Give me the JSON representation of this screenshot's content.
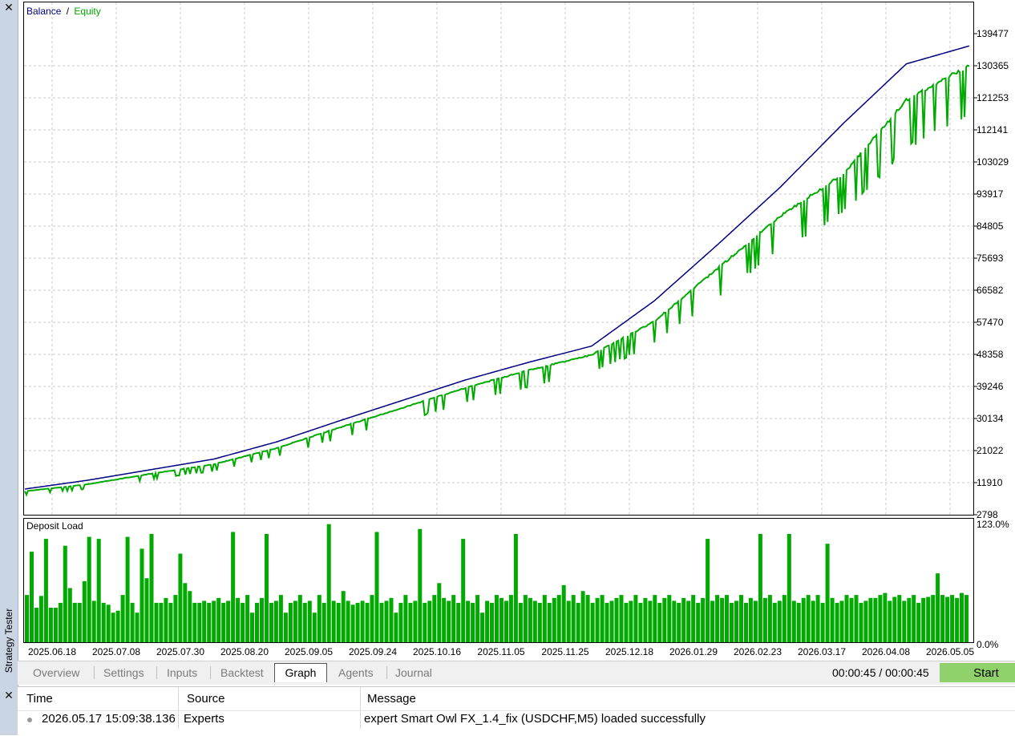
{
  "window": {
    "title": "Strategy Tester"
  },
  "chart": {
    "legend_balance": "Balance",
    "legend_separator": "/",
    "legend_equity": "Equity",
    "deposit_title": "Deposit Load",
    "colors": {
      "balance": "#000080",
      "equity": "#00aa00",
      "deposit": "#00aa00",
      "grid": "#c8c8c8"
    }
  },
  "chart_data": [
    {
      "type": "line",
      "title": "",
      "series": [
        {
          "name": "Balance",
          "color": "#000080",
          "x": [
            "2025.06.18",
            "2025.07.08",
            "2025.07.30",
            "2025.08.20",
            "2025.09.05",
            "2025.09.24",
            "2025.10.16",
            "2025.11.05",
            "2025.11.25",
            "2025.12.18",
            "2026.01.29",
            "2026.02.23",
            "2026.03.17",
            "2026.04.08",
            "2026.05.05",
            "2026.05.17"
          ],
          "values": [
            10100,
            12600,
            15600,
            18600,
            23500,
            29500,
            35300,
            41100,
            46100,
            50700,
            63600,
            79500,
            95900,
            114000,
            130900,
            136000
          ]
        },
        {
          "name": "Equity",
          "color": "#00aa00",
          "x": [
            "2025.06.18",
            "2025.07.08",
            "2025.07.30",
            "2025.08.20",
            "2025.09.05",
            "2025.09.24",
            "2025.10.16",
            "2025.11.05",
            "2025.11.25",
            "2025.12.18",
            "2026.01.29",
            "2026.02.23",
            "2026.03.17",
            "2026.04.08",
            "2026.05.05",
            "2026.05.17"
          ],
          "values": [
            9500,
            11500,
            14500,
            17200,
            21800,
            27700,
            33300,
            39000,
            44000,
            48400,
            58000,
            73000,
            88000,
            100000,
            121000,
            131000
          ]
        }
      ],
      "y_ticks": [
        "139477",
        "130365",
        "121253",
        "112141",
        "103029",
        "93917",
        "84805",
        "75693",
        "66582",
        "57470",
        "48358",
        "39246",
        "30134",
        "21022",
        "11910",
        "2798"
      ],
      "ylim": [
        2798,
        139477
      ]
    },
    {
      "type": "bar",
      "title": "Deposit Load",
      "y_ticks": [
        "123.0%",
        "0.0%"
      ],
      "ylim": [
        0,
        123
      ],
      "x_ticks": [
        "2025.06.18",
        "2025.07.08",
        "2025.07.30",
        "2025.08.20",
        "2025.09.05",
        "2025.09.24",
        "2025.10.16",
        "2025.11.05",
        "2025.11.25",
        "2025.12.18",
        "2026.01.29",
        "2026.02.23",
        "2026.03.17",
        "2026.04.08",
        "2026.05.05"
      ],
      "values": [
        48,
        92,
        35,
        47,
        105,
        35,
        35,
        40,
        98,
        55,
        40,
        40,
        62,
        107,
        42,
        105,
        40,
        38,
        30,
        32,
        48,
        107,
        40,
        30,
        95,
        65,
        110,
        40,
        40,
        45,
        40,
        48,
        90,
        60,
        52,
        40,
        40,
        42,
        40,
        42,
        45,
        40,
        42,
        112,
        45,
        40,
        48,
        30,
        40,
        45,
        110,
        40,
        42,
        48,
        30,
        40,
        42,
        48,
        40,
        42,
        30,
        48,
        40,
        120,
        42,
        40,
        52,
        42,
        38,
        40,
        42,
        40,
        48,
        112,
        40,
        42,
        45,
        30,
        40,
        48,
        40,
        42,
        115,
        40,
        42,
        48,
        60,
        45,
        42,
        48,
        40,
        105,
        42,
        40,
        48,
        30,
        42,
        40,
        48,
        45,
        42,
        48,
        110,
        40,
        48,
        45,
        42,
        40,
        48,
        40,
        45,
        48,
        58,
        42,
        48,
        40,
        52,
        48,
        40,
        45,
        48,
        40,
        42,
        45,
        48,
        40,
        42,
        48,
        40,
        45,
        42,
        48,
        40,
        45,
        48,
        42,
        40,
        45,
        42,
        48,
        40,
        45,
        105,
        42,
        48,
        45,
        48,
        40,
        42,
        48,
        40,
        45,
        42,
        110,
        45,
        48,
        40,
        42,
        48,
        110,
        42,
        40,
        45,
        48,
        42,
        48,
        40,
        100,
        45,
        40,
        42,
        48,
        45,
        48,
        40,
        42,
        45,
        45,
        48,
        50,
        42,
        46,
        48,
        42,
        45,
        48,
        40,
        45,
        46,
        48,
        70,
        48,
        46,
        48,
        45,
        50,
        48
      ]
    }
  ],
  "tabs": [
    {
      "label": "Overview",
      "active": false
    },
    {
      "label": "Settings",
      "active": false
    },
    {
      "label": "Inputs",
      "active": false
    },
    {
      "label": "Backtest",
      "active": false
    },
    {
      "label": "Graph",
      "active": true
    },
    {
      "label": "Agents",
      "active": false
    },
    {
      "label": "Journal",
      "active": false
    }
  ],
  "timer": "00:00:45 / 00:00:45",
  "start_button": "Start",
  "journal": {
    "col_time": "Time",
    "col_source": "Source",
    "col_message": "Message",
    "rows": [
      {
        "time": "2026.05.17 15:09:38.136",
        "source": "Experts",
        "message": "expert Smart Owl FX_1.4_fix (USDCHF,M5) loaded successfully"
      }
    ]
  }
}
